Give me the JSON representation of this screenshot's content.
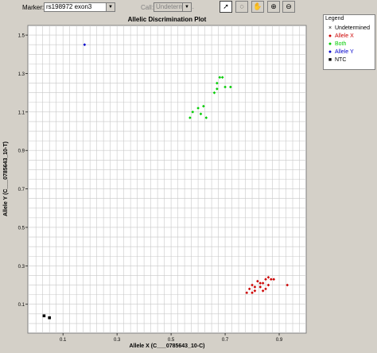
{
  "toolbar": {
    "marker_label": "Marker:",
    "marker_value": "rs198972 exon3",
    "call_label": "Call:",
    "call_value": "Undetermin..."
  },
  "legend": {
    "title": "Legend",
    "items": [
      {
        "label": "Undetermined",
        "symbol": "×",
        "color": "#000000"
      },
      {
        "label": "Allele X",
        "symbol": "●",
        "color": "#cc0000"
      },
      {
        "label": "Both",
        "symbol": "●",
        "color": "#00cc00"
      },
      {
        "label": "Allele Y",
        "symbol": "●",
        "color": "#0000cc"
      },
      {
        "label": "NTC",
        "symbol": "■",
        "color": "#000000"
      }
    ]
  },
  "chart_data": {
    "type": "scatter",
    "title": "Allelic Discrimination Plot",
    "xlabel": "Allele X (C___0785643_10-C)",
    "ylabel": "Allele Y (C___0785643_10-T)",
    "xlim": [
      -0.03,
      1.0
    ],
    "ylim": [
      -0.05,
      1.55
    ],
    "xticks": [
      0.1,
      0.3,
      0.5,
      0.7,
      0.9
    ],
    "yticks": [
      0.1,
      0.3,
      0.5,
      0.7,
      0.9,
      1.1,
      1.3,
      1.5
    ],
    "grid": true,
    "legend_position": "right",
    "series": [
      {
        "name": "Allele X",
        "color": "#cc0000",
        "shape": "diamond",
        "points": [
          [
            0.78,
            0.16
          ],
          [
            0.79,
            0.18
          ],
          [
            0.8,
            0.2
          ],
          [
            0.81,
            0.17
          ],
          [
            0.82,
            0.22
          ],
          [
            0.83,
            0.19
          ],
          [
            0.84,
            0.21
          ],
          [
            0.85,
            0.23
          ],
          [
            0.86,
            0.2
          ],
          [
            0.87,
            0.23
          ],
          [
            0.85,
            0.18
          ],
          [
            0.83,
            0.21
          ],
          [
            0.81,
            0.19
          ],
          [
            0.88,
            0.23
          ],
          [
            0.93,
            0.2
          ],
          [
            0.86,
            0.24
          ],
          [
            0.84,
            0.17
          ],
          [
            0.8,
            0.16
          ]
        ]
      },
      {
        "name": "Both",
        "color": "#00cc00",
        "shape": "diamond",
        "points": [
          [
            0.57,
            1.07
          ],
          [
            0.58,
            1.1
          ],
          [
            0.6,
            1.12
          ],
          [
            0.61,
            1.09
          ],
          [
            0.62,
            1.13
          ],
          [
            0.63,
            1.07
          ],
          [
            0.66,
            1.2
          ],
          [
            0.67,
            1.25
          ],
          [
            0.68,
            1.28
          ],
          [
            0.69,
            1.28
          ],
          [
            0.7,
            1.23
          ],
          [
            0.72,
            1.23
          ],
          [
            0.67,
            1.22
          ]
        ]
      },
      {
        "name": "Allele Y",
        "color": "#0000cc",
        "shape": "diamond",
        "points": [
          [
            0.18,
            1.45
          ]
        ]
      },
      {
        "name": "NTC",
        "color": "#000000",
        "shape": "square",
        "points": [
          [
            0.03,
            0.04
          ],
          [
            0.05,
            0.03
          ]
        ]
      }
    ]
  }
}
